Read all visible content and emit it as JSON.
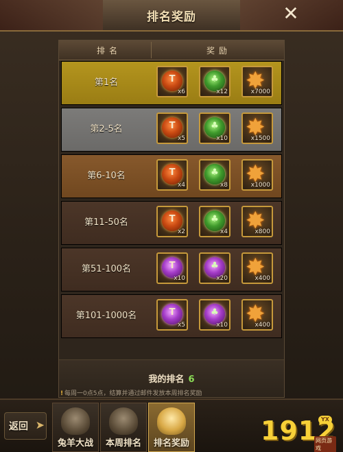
{
  "header": {
    "title": "排名奖励",
    "close_icon": "close-icon"
  },
  "table": {
    "col_rank": "排名",
    "col_reward": "奖励",
    "rows": [
      {
        "rank": "第1名",
        "tier": "gold",
        "items": [
          {
            "icon": "red-orb-icon",
            "count": "x6"
          },
          {
            "icon": "green-orb-icon",
            "count": "x12"
          },
          {
            "icon": "star-badge-icon",
            "count": "x7000"
          }
        ]
      },
      {
        "rank": "第2-5名",
        "tier": "silver",
        "items": [
          {
            "icon": "red-orb-icon",
            "count": "x5"
          },
          {
            "icon": "green-orb-icon",
            "count": "x10"
          },
          {
            "icon": "star-badge-icon",
            "count": "x1500"
          }
        ]
      },
      {
        "rank": "第6-10名",
        "tier": "bronze",
        "items": [
          {
            "icon": "red-orb-icon",
            "count": "x4"
          },
          {
            "icon": "green-orb-icon",
            "count": "x8"
          },
          {
            "icon": "star-badge-icon",
            "count": "x1000"
          }
        ]
      },
      {
        "rank": "第11-50名",
        "tier": "plain",
        "items": [
          {
            "icon": "red-orb-icon",
            "count": "x2"
          },
          {
            "icon": "green-orb-icon",
            "count": "x4"
          },
          {
            "icon": "star-badge-icon",
            "count": "x800"
          }
        ]
      },
      {
        "rank": "第51-100名",
        "tier": "plain",
        "items": [
          {
            "icon": "purple-orb-icon",
            "count": "x10"
          },
          {
            "icon": "purple-green-orb-icon",
            "count": "x20"
          },
          {
            "icon": "star-badge-icon",
            "count": "x400"
          }
        ]
      },
      {
        "rank": "第101-1000名",
        "tier": "plain",
        "items": [
          {
            "icon": "purple-orb-icon",
            "count": "x5"
          },
          {
            "icon": "purple-green-orb-icon",
            "count": "x10"
          },
          {
            "icon": "star-badge-icon",
            "count": "x400"
          }
        ]
      }
    ]
  },
  "my_rank": {
    "label": "我的排名",
    "value": "6"
  },
  "tip": "每周一0点5点，结算并通过邮件发放本周排名奖励",
  "bottom": {
    "back_label": "返回",
    "tabs": [
      {
        "label": "兔羊大战",
        "active": false
      },
      {
        "label": "本周排名",
        "active": false
      },
      {
        "label": "排名奖励",
        "active": true
      }
    ]
  },
  "logo": {
    "digits": "1912",
    "badge": "YX",
    "sub": "网页游戏"
  },
  "colors": {
    "gold_row": "#b4951e",
    "silver_row": "#7c7b79",
    "bronze_row": "#87592c",
    "plain_row": "#4c3628",
    "accent_green": "#8bdc56"
  }
}
